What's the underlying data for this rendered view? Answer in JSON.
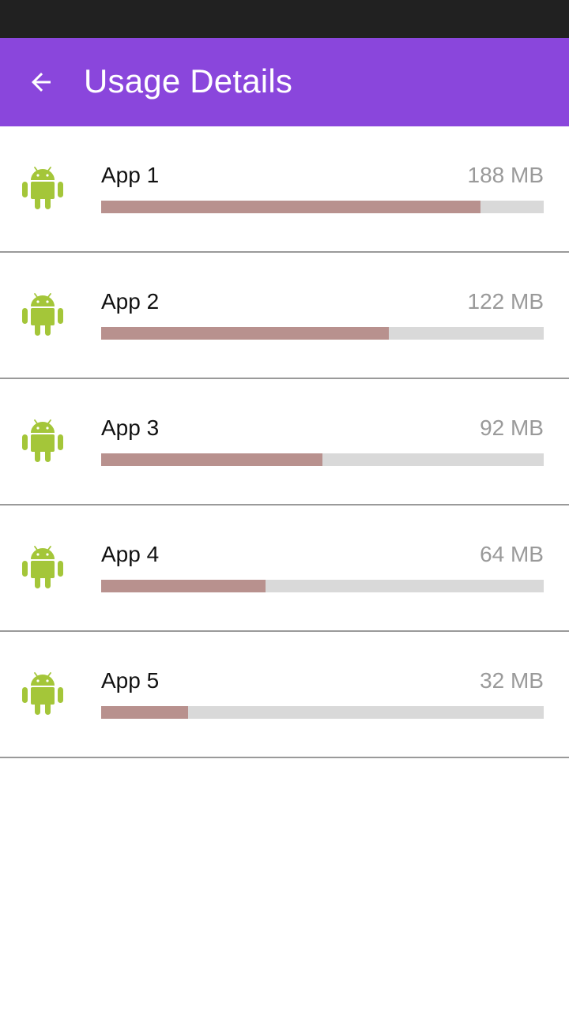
{
  "header": {
    "title": "Usage Details",
    "back_icon": "arrow-back-icon",
    "color": "#8a46dc"
  },
  "apps": [
    {
      "name": "App 1",
      "size": "188 MB",
      "usage_fraction": 0.857,
      "icon": "android-icon"
    },
    {
      "name": "App 2",
      "size": "122 MB",
      "usage_fraction": 0.65,
      "icon": "android-icon"
    },
    {
      "name": "App 3",
      "size": "92 MB",
      "usage_fraction": 0.5,
      "icon": "android-icon"
    },
    {
      "name": "App 4",
      "size": "64 MB",
      "usage_fraction": 0.371,
      "icon": "android-icon"
    },
    {
      "name": "App 5",
      "size": "32 MB",
      "usage_fraction": 0.196,
      "icon": "android-icon"
    }
  ],
  "colors": {
    "bar_fill": "#b8918e",
    "bar_track": "#d9d9d9",
    "android_green": "#a4c639"
  }
}
